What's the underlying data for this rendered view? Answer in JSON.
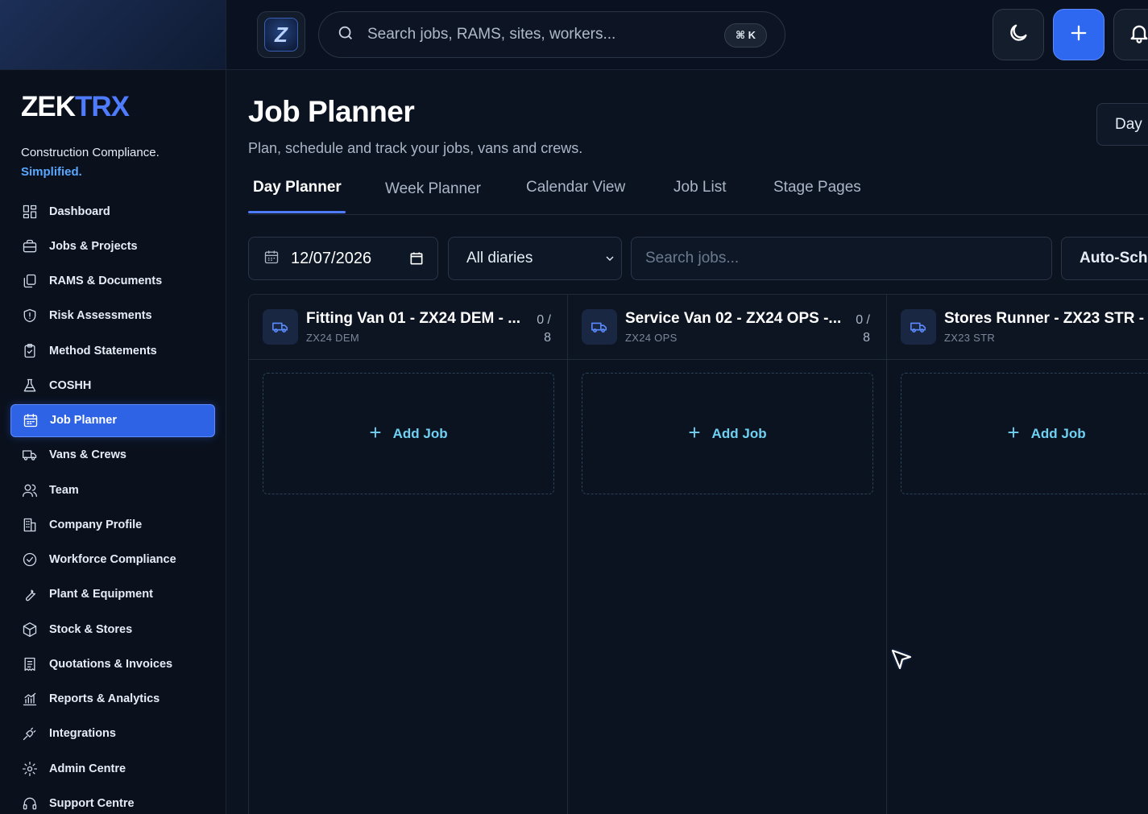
{
  "brand": {
    "part1": "ZEK",
    "part2": "TRX"
  },
  "tagline": {
    "line1": "Construction Compliance.",
    "line2": "Simplified."
  },
  "logo_letter": "Z",
  "sidebar": {
    "items": [
      {
        "label": "Dashboard",
        "icon": "grid-icon"
      },
      {
        "label": "Jobs & Projects",
        "icon": "briefcase-icon"
      },
      {
        "label": "RAMS & Documents",
        "icon": "documents-icon"
      },
      {
        "label": "Risk Assessments",
        "icon": "shield-icon"
      },
      {
        "label": "Method Statements",
        "icon": "clipboard-icon"
      },
      {
        "label": "COSHH",
        "icon": "flask-icon"
      },
      {
        "label": "Job Planner",
        "icon": "calendar-icon",
        "active": true
      },
      {
        "label": "Vans & Crews",
        "icon": "truck-icon"
      },
      {
        "label": "Team",
        "icon": "users-icon"
      },
      {
        "label": "Company Profile",
        "icon": "building-icon"
      },
      {
        "label": "Workforce Compliance",
        "icon": "check-circle-icon"
      },
      {
        "label": "Plant & Equipment",
        "icon": "wrench-icon"
      },
      {
        "label": "Stock & Stores",
        "icon": "box-icon"
      },
      {
        "label": "Quotations & Invoices",
        "icon": "receipt-icon"
      },
      {
        "label": "Reports & Analytics",
        "icon": "chart-icon"
      },
      {
        "label": "Integrations",
        "icon": "plug-icon"
      },
      {
        "label": "Admin Centre",
        "icon": "gear-icon"
      },
      {
        "label": "Support Centre",
        "icon": "headset-icon"
      }
    ]
  },
  "topbar": {
    "search_placeholder": "Search jobs, RAMS, sites, workers...",
    "shortcut": "⌘ K"
  },
  "page": {
    "title": "Job Planner",
    "subtitle": "Plan, schedule and track your jobs, vans and crews.",
    "view_button": "Day",
    "tabs": [
      "Day Planner",
      "Week Planner",
      "Calendar View",
      "Job List",
      "Stage Pages"
    ],
    "active_tab": "Day Planner"
  },
  "filters": {
    "date": "12/07/2026",
    "diary": "All diaries",
    "job_search_placeholder": "Search jobs...",
    "auto_button": "Auto-Sch"
  },
  "columns": [
    {
      "title": "Fitting Van 01 - ZX24 DEM - ...",
      "code": "ZX24 DEM",
      "count_line1": "0 /",
      "count_line2": "8",
      "add_label": "Add Job"
    },
    {
      "title": "Service Van 02 - ZX24 OPS -...",
      "code": "ZX24 OPS",
      "count_line1": "0 /",
      "count_line2": "8",
      "add_label": "Add Job"
    },
    {
      "title": "Stores Runner - ZX23 STR -",
      "code": "ZX23 STR",
      "count_line1": "",
      "count_line2": "",
      "add_label": "Add Job"
    }
  ],
  "colors": {
    "accent": "#2f63e6",
    "brand_blue": "#4f7cff",
    "add_job": "#6fd1f2",
    "background": "#0b1220"
  }
}
